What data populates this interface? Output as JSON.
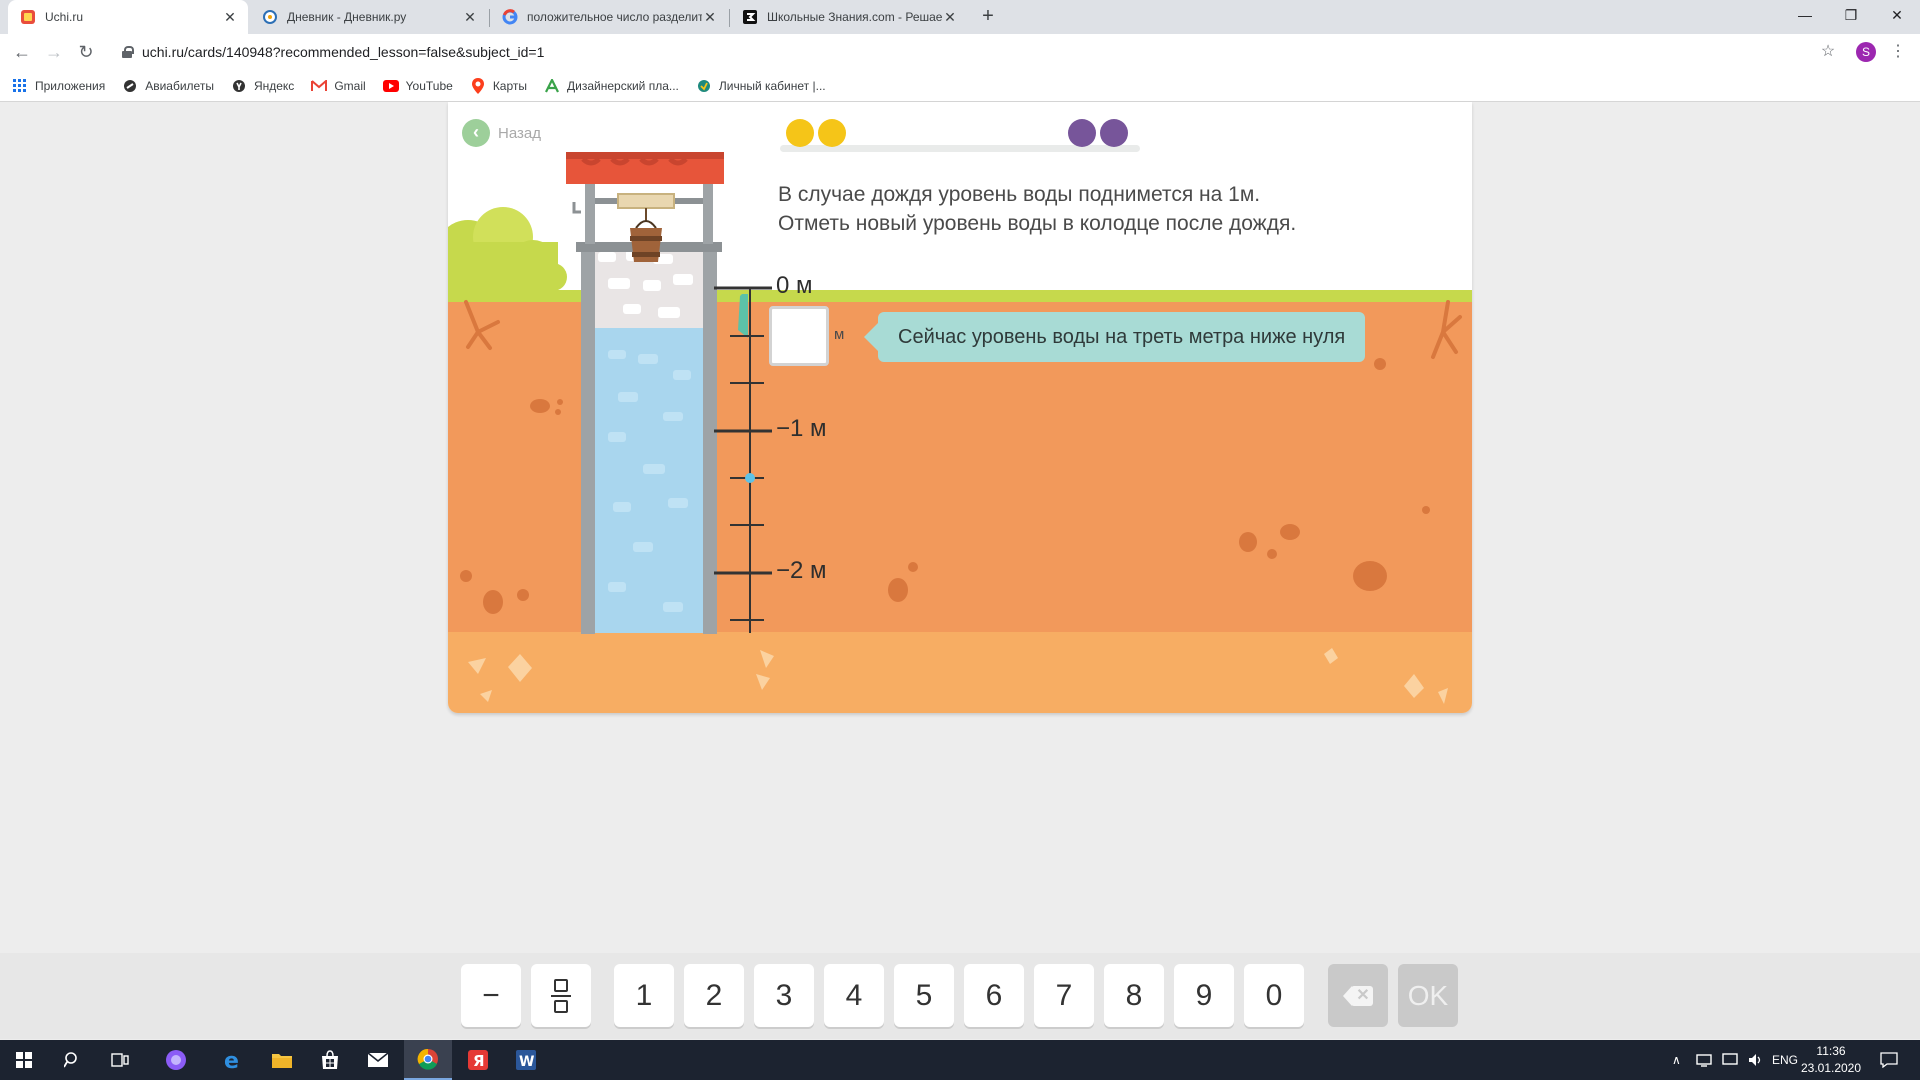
{
  "browser": {
    "tabs": [
      {
        "title": "Uchi.ru",
        "icon": "uchi-favicon",
        "active": true
      },
      {
        "title": "Дневник - Дневник.ру",
        "icon": "dnevnik-favicon",
        "active": false
      },
      {
        "title": "положительное число разделит",
        "icon": "google-favicon",
        "active": false
      },
      {
        "title": "Школьные Знания.com - Решае",
        "icon": "znanija-favicon",
        "active": false
      }
    ],
    "new_tab": "+",
    "url": "uchi.ru/cards/140948?recommended_lesson=false&subject_id=1",
    "profile_initial": "S",
    "bookmarks": [
      {
        "label": "Приложения",
        "icon": "apps-grid-icon"
      },
      {
        "label": "Авиабилеты",
        "icon": "aviasales-icon"
      },
      {
        "label": "Яндекс",
        "icon": "yandex-icon"
      },
      {
        "label": "Gmail",
        "icon": "gmail-icon"
      },
      {
        "label": "YouTube",
        "icon": "youtube-icon"
      },
      {
        "label": "Карты",
        "icon": "maps-icon"
      },
      {
        "label": "Дизайнерский пла...",
        "icon": "designer-icon"
      },
      {
        "label": "Личный кабинет |...",
        "icon": "cabinet-icon"
      }
    ]
  },
  "lesson": {
    "back_label": "Назад",
    "progress": {
      "completed_yellow": 2,
      "pending_purple": 2
    },
    "task_line1": "В случае дождя уровень воды поднимется на 1м.",
    "task_line2": "Отметь новый уровень воды в колодце после дождя.",
    "scale_labels": {
      "zero": "0 м",
      "minus_one": "−1 м",
      "minus_two": "−2 м"
    },
    "answer_value": "",
    "answer_unit": "м",
    "hint": "Сейчас уровень воды на треть метра ниже нуля",
    "current_level_m": -0.3333
  },
  "keyboard": {
    "minus": "−",
    "digits": [
      "1",
      "2",
      "3",
      "4",
      "5",
      "6",
      "7",
      "8",
      "9",
      "0"
    ],
    "ok": "OK"
  },
  "taskbar": {
    "lang": "ENG",
    "time": "11:36",
    "date": "23.01.2020"
  },
  "colors": {
    "ground": "#f2995b",
    "ground_bottom": "#f7ad63",
    "grass": "#c6d94c",
    "water": "#a9d6ee",
    "well_roof": "#e7553a",
    "hint_bg": "#a8dbd5",
    "progress_done": "#f5c518",
    "progress_pending": "#77559a"
  }
}
